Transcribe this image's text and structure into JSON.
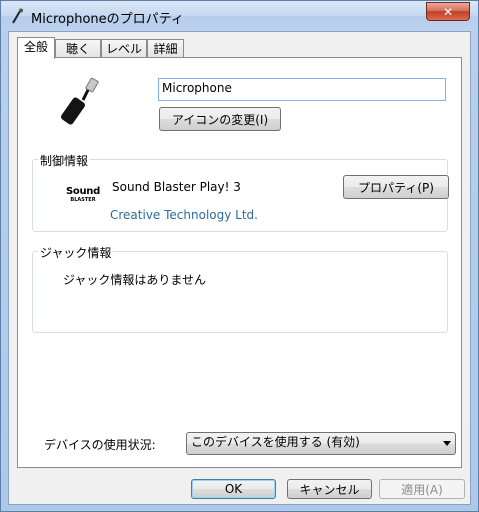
{
  "window": {
    "title": "Microphoneのプロパティ",
    "close_symbol": "✕"
  },
  "tabs": [
    {
      "label": "全般",
      "active": true
    },
    {
      "label": "聴く",
      "active": false
    },
    {
      "label": "レベル",
      "active": false
    },
    {
      "label": "詳細",
      "active": false
    }
  ],
  "general": {
    "device_name": "Microphone",
    "change_icon_label": "アイコンの変更(I)"
  },
  "controller": {
    "group_title": "制御情報",
    "logo_line1": "Sound",
    "logo_line2": "BLASTER",
    "device": "Sound Blaster Play! 3",
    "vendor": "Creative Technology Ltd.",
    "properties_label": "プロパティ(P)",
    "vendor_color": "#2e6b9e"
  },
  "jack": {
    "group_title": "ジャック情報",
    "message": "ジャック情報はありません"
  },
  "usage": {
    "label": "デバイスの使用状況:",
    "selected": "このデバイスを使用する (有効)"
  },
  "footer": {
    "ok_label": "OK",
    "cancel_label": "キャンセル",
    "apply_label": "適用(A)"
  }
}
